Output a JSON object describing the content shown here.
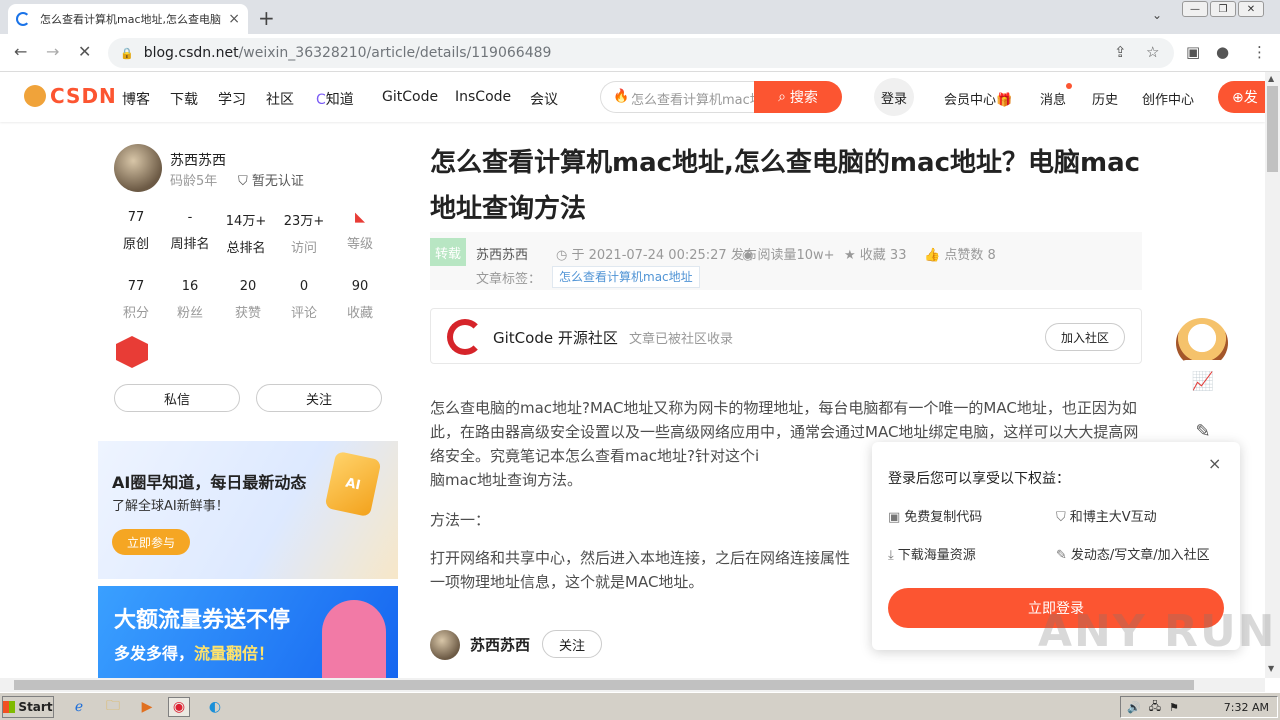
{
  "browser": {
    "tab_title": "怎么查看计算机mac地址,怎么查电脑",
    "url_host": "blog.csdn.net",
    "url_path": "/weixin_36328210/article/details/119066489",
    "new_tab": "+",
    "tab_close": "×"
  },
  "csdn_nav": {
    "logo": "CSDN",
    "links": [
      "博客",
      "下载",
      "学习",
      "社区",
      "知道",
      "GitCode",
      "InsCode",
      "会议"
    ],
    "search_placeholder": "怎么查看计算机mac地址",
    "search_button": "搜索",
    "login": "登录",
    "right_links": [
      "会员中心",
      "消息",
      "历史",
      "创作中心"
    ],
    "publish": "发"
  },
  "profile": {
    "name": "苏西苏西",
    "years": "码龄5年",
    "cert": "暂无认证",
    "stats_row1": [
      {
        "value": "77",
        "label": "原创"
      },
      {
        "value": "-",
        "label": "周排名"
      },
      {
        "value": "14万+",
        "label": "总排名"
      },
      {
        "value": "23万+",
        "label": "访问"
      },
      {
        "value": "",
        "label": "等级"
      }
    ],
    "stats_row2": [
      {
        "value": "77",
        "label": "积分"
      },
      {
        "value": "16",
        "label": "粉丝"
      },
      {
        "value": "20",
        "label": "获赞"
      },
      {
        "value": "0",
        "label": "评论"
      },
      {
        "value": "90",
        "label": "收藏"
      }
    ],
    "message_button": "私信",
    "follow_button": "关注"
  },
  "banners": {
    "ai_title": "AI圈早知道，每日最新动态",
    "ai_sub": "了解全球AI新鲜事！",
    "ai_button": "立即参与",
    "ai_cube": "AI",
    "flow_title": "大额流量券送不停",
    "flow_sub_a": "多发多得，",
    "flow_sub_b": "流量翻倍！"
  },
  "article": {
    "title": "怎么查看计算机mac地址,怎么查电脑的mac地址？电脑mac地址查询方法",
    "repost": "转载",
    "author": "苏西苏西",
    "date": "于 2021-07-24 00:25:27 发布",
    "reads": "阅读量10w+",
    "favorites": "收藏 33",
    "likes": "点赞数 8",
    "tag_label": "文章标签：",
    "tag": "怎么查看计算机mac地址",
    "gitcode_name": "GitCode 开源社区",
    "gitcode_sub": "文章已被社区收录",
    "gitcode_join": "加入社区",
    "para1": "怎么查电脑的mac地址?MAC地址又称为网卡的物理地址，每台电脑都有一个唯一的MAC地址，也正因为如此，在路由器高级安全设置以及一些高级网络应用中，通常会通过MAC地址绑定电脑，这样可以大大提高网络安全。究竟笔记本怎么查看mac地址?针对这个i",
    "para1_tail": "脑mac地址查询方法。",
    "method1": "方法一：",
    "para2": "打开网络和共享中心，然后进入本地连接，之后在网络连接属性",
    "para2_tail": "一项物理地址信息，这个就是MAC地址。"
  },
  "author_bar": {
    "name": "苏西苏西",
    "follow": "关注"
  },
  "login_popup": {
    "title": "登录后您可以享受以下权益：",
    "close": "×",
    "perks": [
      "免费复制代码",
      "和博主大V互动",
      "下载海量资源",
      "发动态/写文章/加入社区"
    ],
    "button": "立即登录"
  },
  "watermark": "ANY RUN",
  "taskbar": {
    "start": "Start",
    "time": "7:32 AM"
  }
}
